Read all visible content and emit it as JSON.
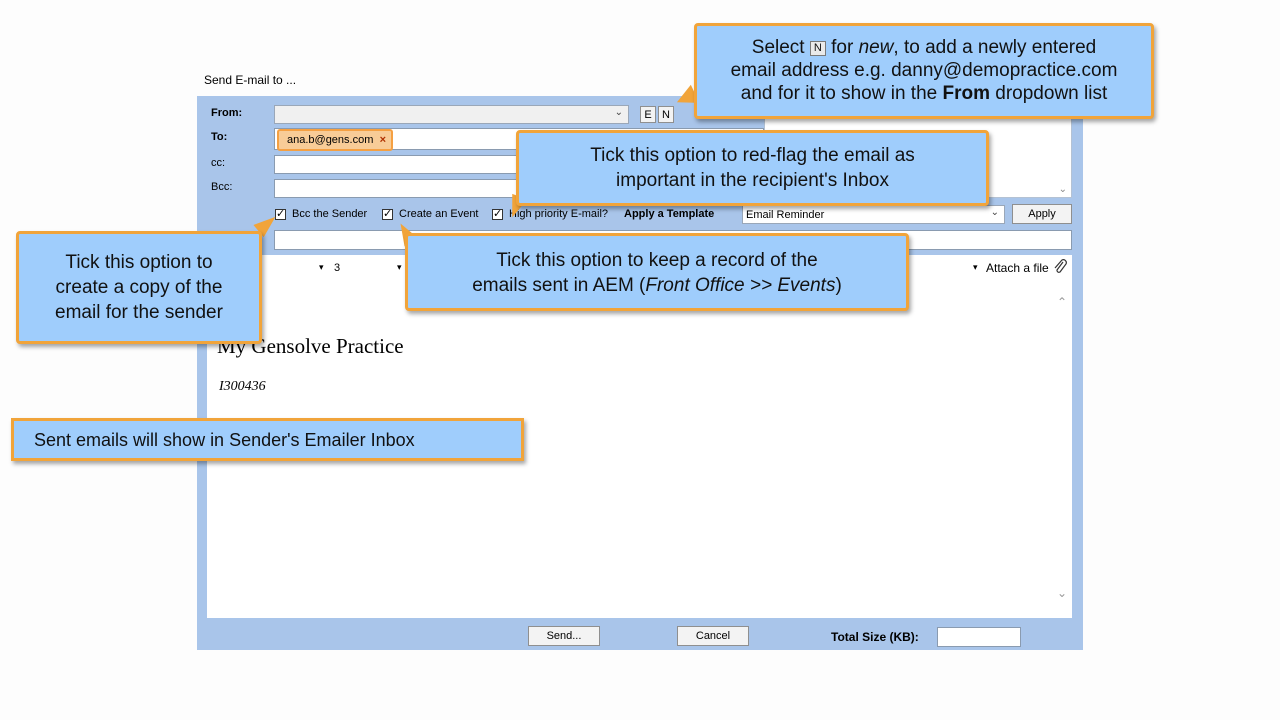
{
  "window": {
    "title": "Send E-mail to ..."
  },
  "header": {
    "from_label": "From:",
    "to_label": "To:",
    "cc_label": "cc:",
    "bcc_label": "Bcc:",
    "e_button": "E",
    "n_button": "N",
    "to_chip": "ana.b@gens.com",
    "chip_remove": "×"
  },
  "options": {
    "bcc_sender": "Bcc the Sender",
    "create_event": "Create an Event",
    "high_priority": "High priority E-mail?",
    "apply_template_label": "Apply a Template",
    "template_value": "Email Reminder",
    "apply_button": "Apply"
  },
  "toolbar": {
    "font_size": "3",
    "attach_label": "Attach a file"
  },
  "editor": {
    "practice_name": "My Gensolve Practice",
    "reference": "I300436"
  },
  "footer": {
    "send_button": "Send...",
    "cancel_button": "Cancel",
    "total_size_label": "Total Size (KB):",
    "total_size_value": ""
  },
  "callouts": {
    "new_address": {
      "pre": "Select",
      "key": "N",
      "mid": "for",
      "em": "new",
      "post": ", to add a newly entered",
      "line2": "email address e.g. danny@demopractice.com",
      "line3_pre": "and for it to show in the",
      "line3_bold": "From",
      "line3_post": "dropdown list"
    },
    "red_flag": {
      "line1": "Tick this option to red-flag the email as",
      "line2": "important in the recipient's Inbox"
    },
    "bcc_copy": {
      "line1": "Tick this option to",
      "line2": "create a copy of the",
      "line3": "email for the sender"
    },
    "event_record": {
      "line1": "Tick this option to keep a record of the",
      "line2_pre": "emails sent in AEM (",
      "line2_em": "Front Office >> Events",
      "line2_post": ")"
    },
    "sent_emails": {
      "text": "Sent emails will show in Sender's Emailer Inbox"
    }
  },
  "colors": {
    "panel": "#a9c5ea",
    "callout_fill": "#9fcdfc",
    "callout_border": "#f1a43a",
    "chip_fill": "#f8cc97"
  }
}
